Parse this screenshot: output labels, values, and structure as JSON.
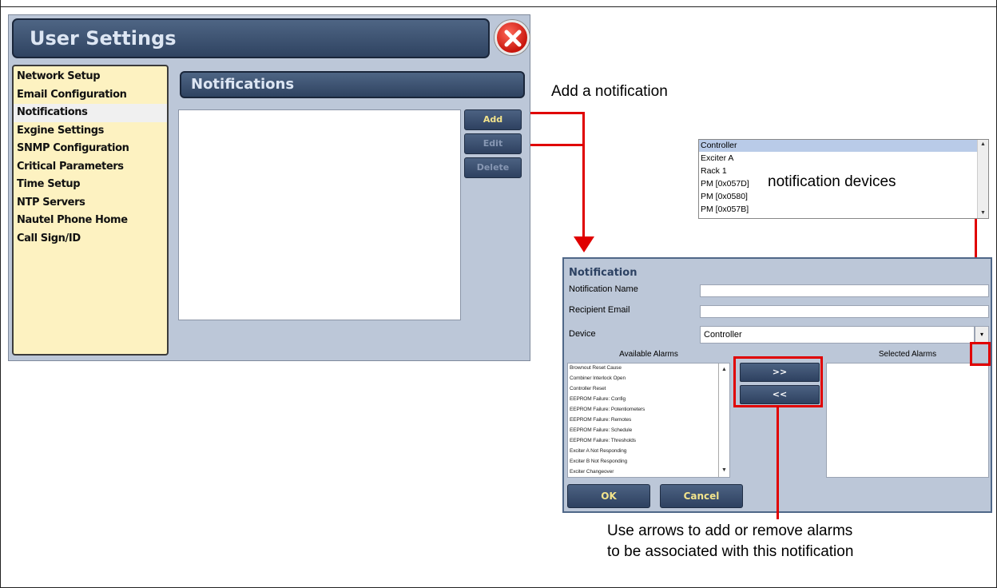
{
  "window": {
    "title": "User Settings"
  },
  "sidebar": {
    "items": [
      {
        "label": "Network Setup"
      },
      {
        "label": "Email Configuration"
      },
      {
        "label": "Notifications",
        "selected": true
      },
      {
        "label": "Exgine Settings"
      },
      {
        "label": "SNMP Configuration"
      },
      {
        "label": "Critical Parameters"
      },
      {
        "label": "Time Setup"
      },
      {
        "label": "NTP Servers"
      },
      {
        "label": "Nautel Phone Home"
      },
      {
        "label": "Call Sign/ID"
      }
    ]
  },
  "notifications_panel": {
    "header": "Notifications",
    "add_label": "Add",
    "edit_label": "Edit",
    "delete_label": "Delete"
  },
  "annotations": {
    "add_notification": "Add a notification",
    "notification_devices": "notification devices",
    "arrows_note_line1": "Use arrows to add or remove alarms",
    "arrows_note_line2": "to be associated with this notification"
  },
  "device_list": {
    "items": [
      "Controller",
      "Exciter A",
      "Rack 1",
      "PM [0x057D]",
      "PM [0x0580]",
      "PM [0x057B]"
    ],
    "selected": "Controller"
  },
  "notification_dialog": {
    "title": "Notification",
    "name_label": "Notification Name",
    "email_label": "Recipient Email",
    "device_label": "Device",
    "device_value": "Controller",
    "available_header": "Available Alarms",
    "selected_header": "Selected Alarms",
    "available_alarms": [
      "Brownout Reset Cause",
      "Combiner Interlock Open",
      "Controller Reset",
      "EEPROM Failure: Config",
      "EEPROM Failure: Potentiometers",
      "EEPROM Failure: Remotes",
      "EEPROM Failure: Schedule",
      "EEPROM Failure: Thresholds",
      "Exciter A Not Responding",
      "Exciter B Not Responding",
      "Exciter Changeover"
    ],
    "add_arrow": ">>",
    "remove_arrow": "<<",
    "ok_label": "OK",
    "cancel_label": "Cancel"
  },
  "colors": {
    "panel_bg": "#bcc7d8",
    "titlebar": "#2f4361",
    "sidebar_bg": "#fdf2c1",
    "button_text": "#f3e48c",
    "callout_red": "#e00000"
  }
}
